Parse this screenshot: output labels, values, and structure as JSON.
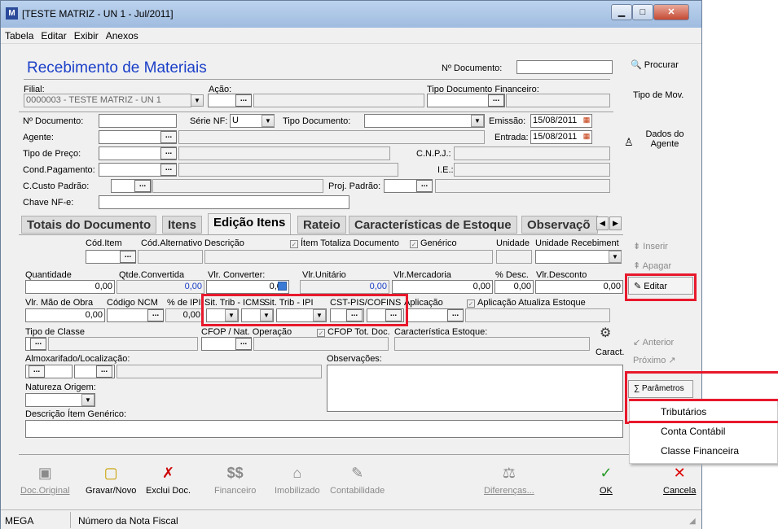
{
  "window": {
    "title": "[TESTE MATRIZ - UN 1 - Jul/2011]",
    "min": "▁",
    "max": "□",
    "close": "✕"
  },
  "menu": [
    "Tabela",
    "Editar",
    "Exibir",
    "Anexos"
  ],
  "header": {
    "title": "Recebimento de Materiais",
    "ndoc_label": "Nº Documento:",
    "ndoc_value": "",
    "procurar": "Procurar",
    "tipo_mov": "Tipo de Mov.",
    "filial_label": "Filial:",
    "filial_value": "0000003 - TESTE MATRIZ - UN 1",
    "acao_label": "Ação:",
    "tipo_doc_fin_label": "Tipo Documento Financeiro:"
  },
  "doc": {
    "ndoc_label": "Nº Documento:",
    "serie_label": "Série NF:",
    "serie_value": "U",
    "tipo_doc_label": "Tipo Documento:",
    "emissao_label": "Emissão:",
    "emissao_value": "15/08/2011",
    "entrada_label": "Entrada:",
    "entrada_value": "15/08/2011",
    "agente_label": "Agente:",
    "tipo_preco_label": "Tipo de Preço:",
    "cnpj_label": "C.N.P.J.:",
    "cond_label": "Cond.Pagamento:",
    "ie_label": "I.E.:",
    "ccusto_label": "C.Custo Padrão:",
    "proj_label": "Proj. Padrão:",
    "chave_label": "Chave NF-e:",
    "dados_agente": "Dados do Agente"
  },
  "tabs": [
    "Totais do Documento",
    "Itens",
    "Edição Itens",
    "Rateio",
    "Características de Estoque",
    "Observaçõ"
  ],
  "items": {
    "cod_item": "Cód.Item",
    "cod_alt": "Cód.Alternativo",
    "descricao": "Descrição",
    "item_totaliza": "Ítem Totaliza Documento",
    "generico": "Genérico",
    "unidade": "Unidade",
    "unidade_receb": "Unidade Recebiment",
    "quantidade": "Quantidade",
    "quantidade_value": "0,00",
    "qtde_conv": "Qtde.Convertida",
    "qtde_conv_value": "0,00",
    "vlr_converter": "Vlr. Converter:",
    "vlr_converter_value": "0,00",
    "vlr_unit": "Vlr.Unitário",
    "vlr_unit_value": "0,00",
    "vlr_merc": "Vlr.Mercadoria",
    "vlr_merc_value": "0,00",
    "desc_pct": "% Desc.",
    "desc_pct_value": "0,00",
    "vlr_desc": "Vlr.Desconto",
    "vlr_desc_value": "0,00",
    "mao_obra": "Vlr. Mão de Obra",
    "mao_obra_value": "0,00",
    "ncm": "Código NCM",
    "ipi_pct": "% de IPI",
    "ipi_value": "0,00",
    "sit_icms": "Sit. Trib - ICMS",
    "sit_ipi": "Sit. Trib - IPI",
    "cst_pis": "CST-PIS/COFINS",
    "aplicacao": "Aplicação",
    "aplic_atualiza": "Aplicação Atualiza Estoque",
    "tipo_classe": "Tipo de Classe",
    "cfop": "CFOP / Nat. Operação",
    "cfop_tot": "CFOP Tot. Doc.",
    "caract_estoque": "Característica Estoque:",
    "caract": "Caract.",
    "almox": "Almoxarifado/Localização:",
    "obs": "Observações:",
    "natureza": "Natureza Origem:",
    "desc_generico": "Descrição Ítem Genérico:"
  },
  "side": {
    "inserir": "Inserir",
    "apagar": "Apagar",
    "editar": "Editar",
    "anterior": "Anterior",
    "proximo": "Próximo",
    "parametros": "Parâmetros"
  },
  "popup": [
    "Tributários",
    "Conta Contábil",
    "Classe Financeira"
  ],
  "toolbar": [
    "Doc.Original",
    "Gravar/Novo",
    "Exclui Doc.",
    "Financeiro",
    "Imobilizado",
    "Contabilidade",
    "Diferenças...",
    "OK",
    "Cancela"
  ],
  "status": {
    "left": "MEGA",
    "right": "Número da Nota Fiscal"
  },
  "colors": {
    "title": "#1a3fc8",
    "highlight": "#e8192c",
    "blue_value": "#1a3fc8"
  }
}
